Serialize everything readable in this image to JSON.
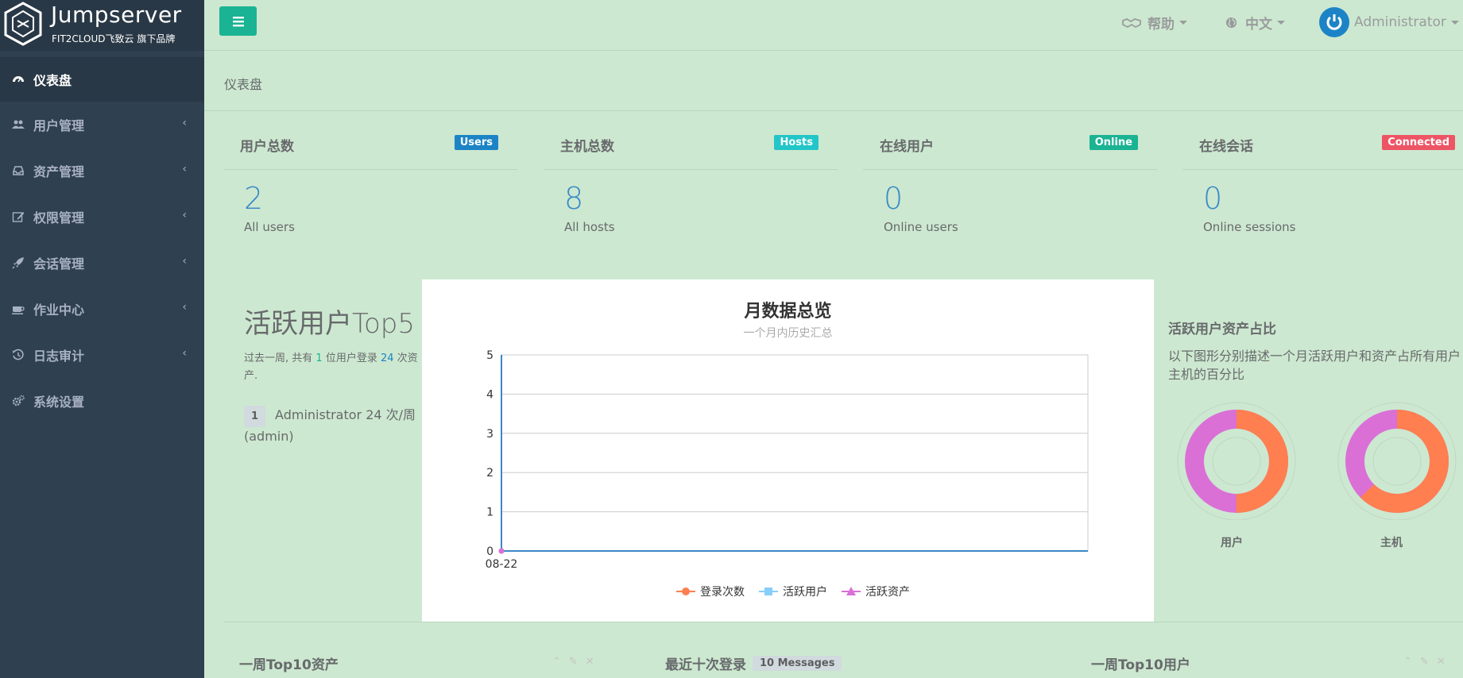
{
  "brand": {
    "name": "Jumpserver",
    "sub": "FIT2CLOUD飞致云 旗下品牌"
  },
  "sidebar": {
    "items": [
      {
        "label": "仪表盘",
        "icon": "dashboard-icon",
        "active": true
      },
      {
        "label": "用户管理",
        "icon": "users-icon"
      },
      {
        "label": "资产管理",
        "icon": "inbox-icon"
      },
      {
        "label": "权限管理",
        "icon": "edit-icon"
      },
      {
        "label": "会话管理",
        "icon": "rocket-icon"
      },
      {
        "label": "作业中心",
        "icon": "coffee-icon"
      },
      {
        "label": "日志审计",
        "icon": "history-icon"
      },
      {
        "label": "系统设置",
        "icon": "gears-icon"
      }
    ],
    "arrow": "‹"
  },
  "topbar": {
    "help_label": "帮助",
    "lang_label": "中文",
    "user_label": "Administrator"
  },
  "breadcrumb": "仪表盘",
  "stats": [
    {
      "title": "用户总数",
      "badge": "Users",
      "badge_color": "#1c84c6",
      "value": "2",
      "desc": "All users"
    },
    {
      "title": "主机总数",
      "badge": "Hosts",
      "badge_color": "#23c6c8",
      "value": "8",
      "desc": "All hosts"
    },
    {
      "title": "在线用户",
      "badge": "Online",
      "badge_color": "#1ab394",
      "value": "0",
      "desc": "Online users"
    },
    {
      "title": "在线会话",
      "badge": "Connected",
      "badge_color": "#ed5565",
      "value": "0",
      "desc": "Online sessions"
    }
  ],
  "top5": {
    "heading": "活跃用户Top5",
    "summary_prefix": "过去一周, 共有 ",
    "user_count": "1",
    "summary_mid": " 位用户登录 ",
    "asset_count": "24",
    "summary_suffix": " 次资产.",
    "entries": [
      {
        "rank": "1",
        "text": "Administrator 24 次/周 (admin)"
      }
    ]
  },
  "chart_data": {
    "type": "line",
    "title": "月数据总览",
    "subtitle": "一个月内历史汇总",
    "x": [
      "08-22"
    ],
    "ylim": [
      0,
      5
    ],
    "yticks": [
      0,
      1,
      2,
      3,
      4,
      5
    ],
    "grid": true,
    "legend_position": "bottom",
    "series": [
      {
        "name": "登录次数",
        "values": [
          0
        ],
        "color": "#ff7f50",
        "marker": "circle"
      },
      {
        "name": "活跃用户",
        "values": [
          0
        ],
        "color": "#87cefa",
        "marker": "square"
      },
      {
        "name": "活跃资产",
        "values": [
          0
        ],
        "color": "#da70d6",
        "marker": "triangle"
      }
    ]
  },
  "ratio": {
    "heading": "活跃用户资产占比",
    "desc": "以下图形分别描述一个月活跃用户和资产占所有用户主机的百分比",
    "donuts": [
      {
        "label": "用户",
        "active_fraction": 0.5
      },
      {
        "label": "主机",
        "active_fraction": 0.625
      }
    ],
    "colors": {
      "active": "#ff7f50",
      "inactive": "#da70d6"
    }
  },
  "bottom": {
    "top10_assets": "一周Top10资产",
    "recent_logins": "最近十次登录",
    "messages_badge": "10 Messages",
    "top10_users": "一周Top10用户"
  }
}
